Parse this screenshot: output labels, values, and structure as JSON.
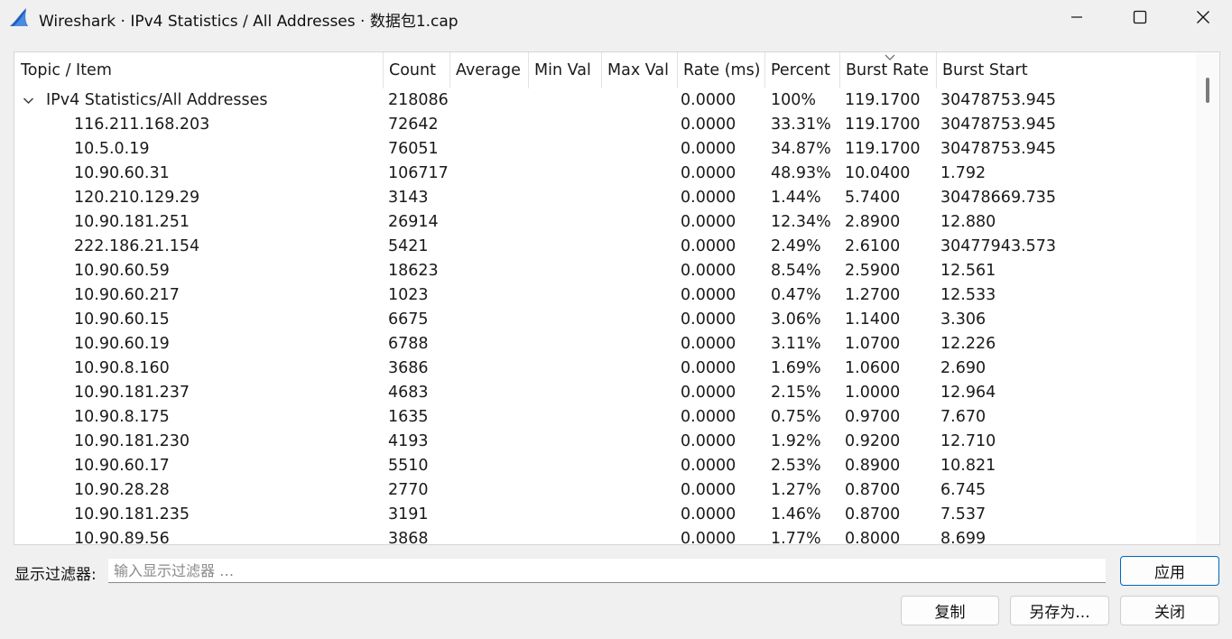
{
  "window": {
    "title": "Wireshark · IPv4 Statistics / All Addresses · 数据包1.cap",
    "icon": "wireshark-fin-icon",
    "controls": [
      "minimize-icon",
      "maximize-icon",
      "close-icon"
    ]
  },
  "table": {
    "columns": [
      "Topic / Item",
      "Count",
      "Average",
      "Min Val",
      "Max Val",
      "Rate (ms)",
      "Percent",
      "Burst Rate",
      "Burst Start"
    ],
    "sorted_column": "Burst Rate",
    "sort_direction": "descending",
    "group": {
      "label": "IPv4 Statistics/All Addresses",
      "expanded": true,
      "count": "218086",
      "average": "",
      "min_val": "",
      "max_val": "",
      "rate": "0.0000",
      "percent": "100%",
      "burst_rate": "119.1700",
      "burst_start": "30478753.945"
    },
    "rows": [
      {
        "item": "116.211.168.203",
        "count": "72642",
        "rate": "0.0000",
        "percent": "33.31%",
        "burst_rate": "119.1700",
        "burst_start": "30478753.945"
      },
      {
        "item": "10.5.0.19",
        "count": "76051",
        "rate": "0.0000",
        "percent": "34.87%",
        "burst_rate": "119.1700",
        "burst_start": "30478753.945"
      },
      {
        "item": "10.90.60.31",
        "count": "106717",
        "rate": "0.0000",
        "percent": "48.93%",
        "burst_rate": "10.0400",
        "burst_start": "1.792"
      },
      {
        "item": "120.210.129.29",
        "count": "3143",
        "rate": "0.0000",
        "percent": "1.44%",
        "burst_rate": "5.7400",
        "burst_start": "30478669.735"
      },
      {
        "item": "10.90.181.251",
        "count": "26914",
        "rate": "0.0000",
        "percent": "12.34%",
        "burst_rate": "2.8900",
        "burst_start": "12.880"
      },
      {
        "item": "222.186.21.154",
        "count": "5421",
        "rate": "0.0000",
        "percent": "2.49%",
        "burst_rate": "2.6100",
        "burst_start": "30477943.573"
      },
      {
        "item": "10.90.60.59",
        "count": "18623",
        "rate": "0.0000",
        "percent": "8.54%",
        "burst_rate": "2.5900",
        "burst_start": "12.561"
      },
      {
        "item": "10.90.60.217",
        "count": "1023",
        "rate": "0.0000",
        "percent": "0.47%",
        "burst_rate": "1.2700",
        "burst_start": "12.533"
      },
      {
        "item": "10.90.60.15",
        "count": "6675",
        "rate": "0.0000",
        "percent": "3.06%",
        "burst_rate": "1.1400",
        "burst_start": "3.306"
      },
      {
        "item": "10.90.60.19",
        "count": "6788",
        "rate": "0.0000",
        "percent": "3.11%",
        "burst_rate": "1.0700",
        "burst_start": "12.226"
      },
      {
        "item": "10.90.8.160",
        "count": "3686",
        "rate": "0.0000",
        "percent": "1.69%",
        "burst_rate": "1.0600",
        "burst_start": "2.690"
      },
      {
        "item": "10.90.181.237",
        "count": "4683",
        "rate": "0.0000",
        "percent": "2.15%",
        "burst_rate": "1.0000",
        "burst_start": "12.964"
      },
      {
        "item": "10.90.8.175",
        "count": "1635",
        "rate": "0.0000",
        "percent": "0.75%",
        "burst_rate": "0.9700",
        "burst_start": "7.670"
      },
      {
        "item": "10.90.181.230",
        "count": "4193",
        "rate": "0.0000",
        "percent": "1.92%",
        "burst_rate": "0.9200",
        "burst_start": "12.710"
      },
      {
        "item": "10.90.60.17",
        "count": "5510",
        "rate": "0.0000",
        "percent": "2.53%",
        "burst_rate": "0.8900",
        "burst_start": "10.821"
      },
      {
        "item": "10.90.28.28",
        "count": "2770",
        "rate": "0.0000",
        "percent": "1.27%",
        "burst_rate": "0.8700",
        "burst_start": "6.745"
      },
      {
        "item": "10.90.181.235",
        "count": "3191",
        "rate": "0.0000",
        "percent": "1.46%",
        "burst_rate": "0.8700",
        "burst_start": "7.537"
      },
      {
        "item": "10.90.89.56",
        "count": "3868",
        "rate": "0.0000",
        "percent": "1.77%",
        "burst_rate": "0.8000",
        "burst_start": "8.699"
      }
    ]
  },
  "filter": {
    "label": "显示过滤器:",
    "placeholder": "输入显示过滤器 …",
    "value": "",
    "apply_label": "应用"
  },
  "buttons": {
    "copy": "复制",
    "save_as": "另存为...",
    "close": "关闭"
  },
  "colors": {
    "window_bg": "#f0f0f0",
    "table_bg": "#ffffff",
    "accent": "#0067c0",
    "icon_blue": "#1f5fbf"
  }
}
